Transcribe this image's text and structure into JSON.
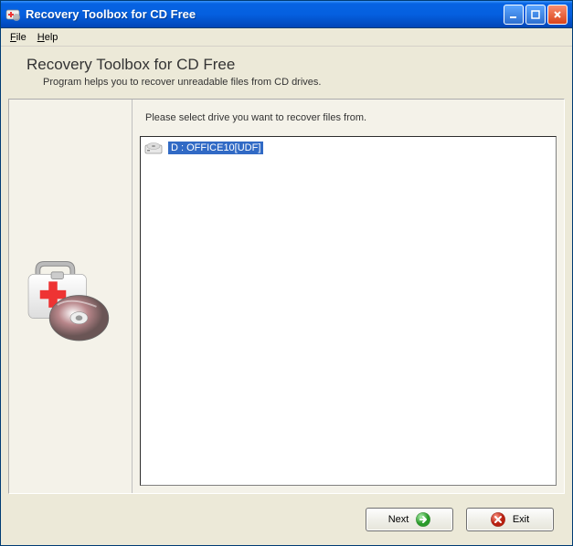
{
  "window": {
    "title": "Recovery Toolbox for CD Free"
  },
  "menu": {
    "file": "File",
    "help": "Help"
  },
  "header": {
    "title": "Recovery Toolbox for CD Free",
    "subtitle": "Program helps you to recover unreadable files from CD drives."
  },
  "main": {
    "instruction": "Please select drive you want to recover files from.",
    "drives": [
      {
        "label": "D : OFFICE10[UDF]",
        "selected": true
      }
    ]
  },
  "footer": {
    "next": "Next",
    "exit": "Exit"
  }
}
